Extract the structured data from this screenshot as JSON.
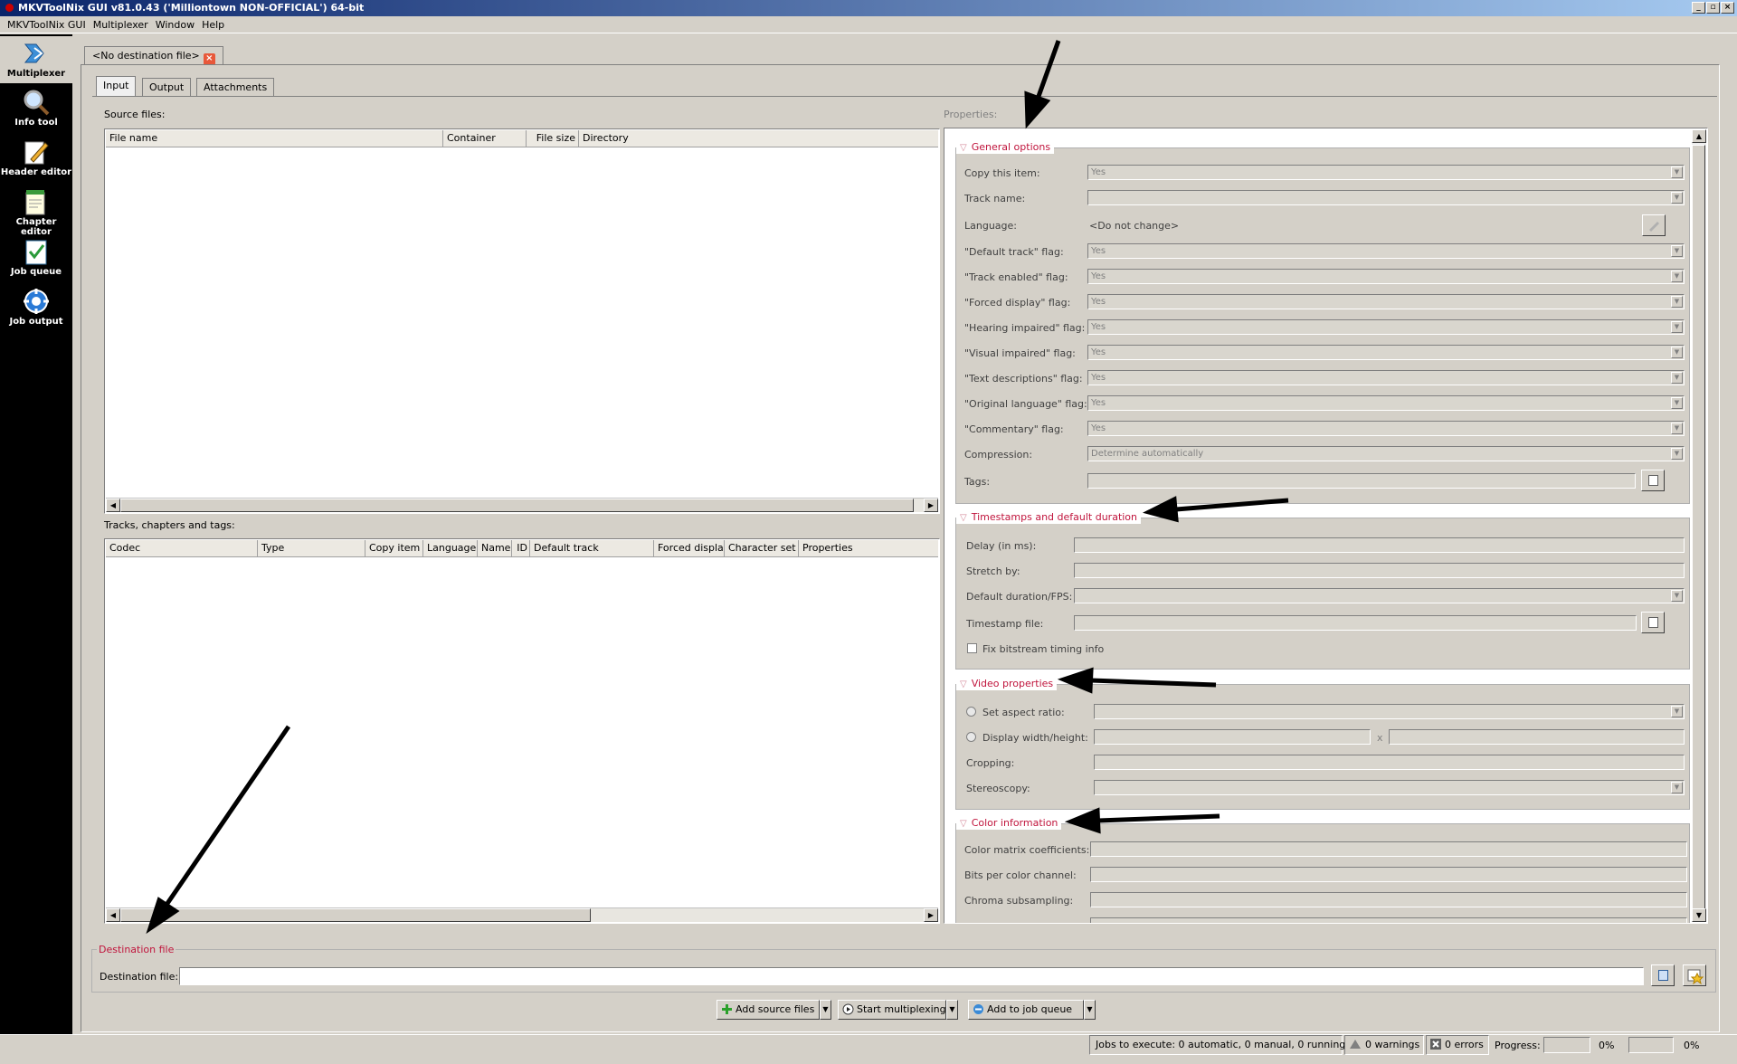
{
  "window": {
    "title": "MKVToolNix GUI v81.0.43 ('Milliontown NON-OFFICIAL') 64-bit"
  },
  "menu": [
    "MKVToolNix GUI",
    "Multiplexer",
    "Window",
    "Help"
  ],
  "sidebar": [
    {
      "label": "Multiplexer",
      "icon": "multiplexer-icon"
    },
    {
      "label": "Info tool",
      "icon": "magnifier-icon"
    },
    {
      "label": "Header editor",
      "icon": "pencil-icon"
    },
    {
      "label": "Chapter editor",
      "icon": "notepad-icon"
    },
    {
      "label": "Job queue",
      "icon": "checklist-icon"
    },
    {
      "label": "Job output",
      "icon": "gear-icon"
    }
  ],
  "document_tab": "<No destination file>",
  "subtabs": [
    "Input",
    "Output",
    "Attachments"
  ],
  "source_files": {
    "label": "Source files:",
    "columns": [
      "File name",
      "Container",
      "File size",
      "Directory"
    ]
  },
  "tracks": {
    "label": "Tracks, chapters and tags:",
    "columns": [
      "Codec",
      "Type",
      "Copy item",
      "Language",
      "Name",
      "ID",
      "Default track",
      "Forced displa",
      "Character set",
      "Properties"
    ]
  },
  "properties": {
    "label": "Properties:",
    "general": {
      "title": "General options",
      "copy_item": {
        "label": "Copy this item:",
        "value": "Yes"
      },
      "track_name": {
        "label": "Track name:"
      },
      "language": {
        "label": "Language:",
        "value": "<Do not change>"
      },
      "default_flag": {
        "label": "\"Default track\" flag:",
        "value": "Yes"
      },
      "enabled_flag": {
        "label": "\"Track enabled\" flag:",
        "value": "Yes"
      },
      "forced_flag": {
        "label": "\"Forced display\" flag:",
        "value": "Yes"
      },
      "hearing_flag": {
        "label": "\"Hearing impaired\" flag:",
        "value": "Yes"
      },
      "visual_flag": {
        "label": "\"Visual impaired\" flag:",
        "value": "Yes"
      },
      "text_desc_flag": {
        "label": "\"Text descriptions\" flag:",
        "value": "Yes"
      },
      "original_flag": {
        "label": "\"Original language\" flag:",
        "value": "Yes"
      },
      "commentary_flag": {
        "label": "\"Commentary\" flag:",
        "value": "Yes"
      },
      "compression": {
        "label": "Compression:",
        "value": "Determine automatically"
      },
      "tags": {
        "label": "Tags:"
      }
    },
    "timestamps": {
      "title": "Timestamps and default duration",
      "delay": "Delay (in ms):",
      "stretch": "Stretch by:",
      "default_duration": "Default duration/FPS:",
      "timestamp_file": "Timestamp file:",
      "fix_timing": "Fix bitstream timing info"
    },
    "video": {
      "title": "Video properties",
      "aspect": "Set aspect ratio:",
      "display_wh": "Display width/height:",
      "x_sep": "x",
      "cropping": "Cropping:",
      "stereoscopy": "Stereoscopy:"
    },
    "color": {
      "title": "Color information",
      "matrix": "Color matrix coefficients:",
      "bits": "Bits per color channel:",
      "chroma": "Chroma subsampling:"
    }
  },
  "destination": {
    "group_title": "Destination file",
    "label": "Destination file:",
    "value": ""
  },
  "actions": {
    "add_source": "Add source files",
    "start_mux": "Start multiplexing",
    "add_queue": "Add to job queue"
  },
  "status": {
    "jobs": "Jobs to execute:  0 automatic, 0 manual, 0 running",
    "warnings": "0 warnings",
    "errors": "0 errors",
    "progress_label": "Progress:",
    "progress_1": "0%",
    "progress_2": "0%",
    "progress_1_value": 0,
    "progress_2_value": 0
  }
}
